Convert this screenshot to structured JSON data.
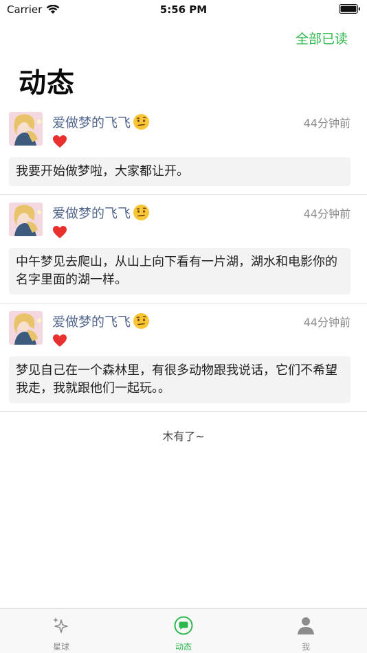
{
  "status_bar": {
    "carrier": "Carrier",
    "time": "5:56 PM"
  },
  "header": {
    "mark_all_read": "全部已读",
    "title": "动态"
  },
  "feed": [
    {
      "username": "爱做梦的飞飞",
      "time": "44分钟前",
      "content": "我要开始做梦啦，大家都让开。"
    },
    {
      "username": "爱做梦的飞飞",
      "time": "44分钟前",
      "content": "中午梦见去爬山，从山上向下看有一片湖，湖水和电影你的名字里面的湖一样。"
    },
    {
      "username": "爱做梦的飞飞",
      "time": "44分钟前",
      "content": "梦见自己在一个森林里，有很多动物跟我说话，它们不希望我走，我就跟他们一起玩。。"
    }
  ],
  "footer_text": "木有了~",
  "tabs": [
    {
      "label": "星球",
      "icon": "sparkles-icon"
    },
    {
      "label": "动态",
      "icon": "chat-bubble-icon",
      "active": true
    },
    {
      "label": "我",
      "icon": "person-icon"
    }
  ],
  "colors": {
    "accent": "#2db84d",
    "username": "#55688f",
    "heart": "#e8312f"
  }
}
